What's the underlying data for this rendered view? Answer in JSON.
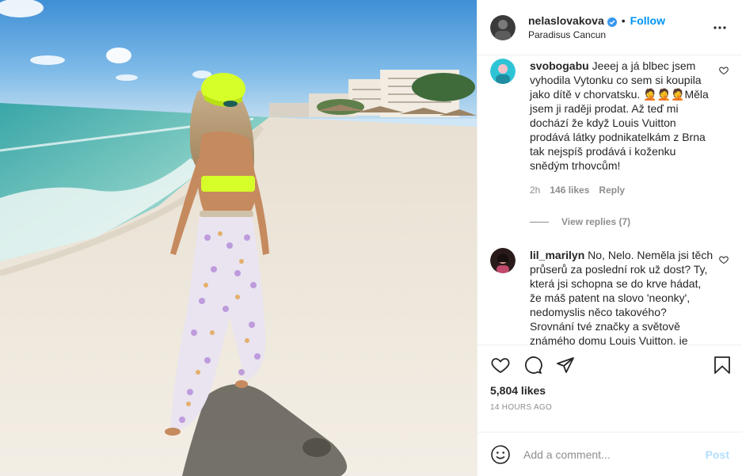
{
  "header": {
    "username": "nelaslovakova",
    "separator": "•",
    "follow_label": "Follow",
    "location": "Paradisus Cancun"
  },
  "comments": [
    {
      "author": "svobogabu",
      "text_part1": "Jeeej a já blbec jsem vyhodila Vytonku co sem si koupila jako dítě v chorvatsku.",
      "emoji": "🤦🤦🤦",
      "text_part2": "Měla jsem ji raději prodat. Až teď mi dochází že když Louis Vuitton prodává látky podnikatelkám z Brna tak nejspíš prodává i koženku snědým trhovcům!",
      "time": "2h",
      "likes": "146 likes",
      "reply_label": "Reply",
      "view_replies": "View replies (7)"
    },
    {
      "author": "lil_marilyn",
      "text": "No, Nelo. Neměla jsi těch průserů za poslední rok už dost? Ty, která jsi schopna se do krve hádat, že máš patent na slovo 'neonky', nedomyslis něco takového? Srovnání tvé značky a světově známého domu Louis Vuitton, je snad pod úroveň všech."
    }
  ],
  "likes": "5,804 likes",
  "time_ago": "14 HOURS AGO",
  "add_comment": {
    "placeholder": "Add a comment...",
    "post_label": "Post"
  },
  "colors": {
    "accent": "#0095f6",
    "post_disabled": "#b2dffc",
    "muted": "#8e8e8e"
  }
}
